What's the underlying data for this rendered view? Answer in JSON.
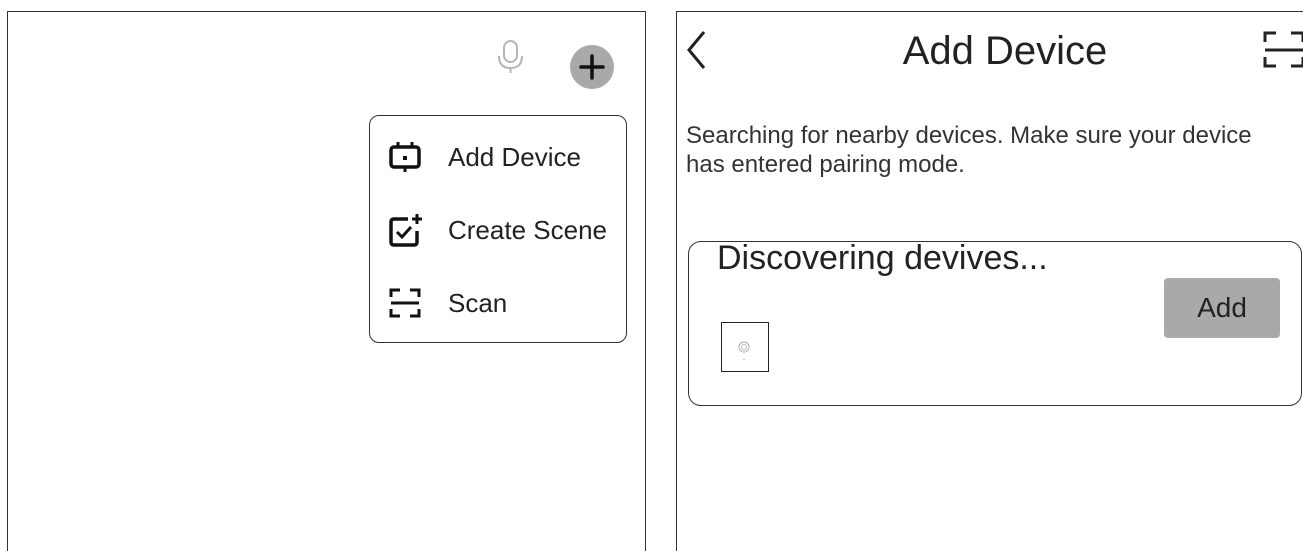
{
  "left_screen": {
    "toolbar": {
      "mic_icon": "microphone-icon",
      "add_icon": "plus-icon"
    },
    "menu": {
      "items": [
        {
          "label": "Add Device",
          "icon": "device-icon"
        },
        {
          "label": "Create Scene",
          "icon": "scene-icon"
        },
        {
          "label": "Scan",
          "icon": "scan-icon"
        }
      ]
    }
  },
  "right_screen": {
    "header": {
      "back_icon": "chevron-left-icon",
      "title": "Add Device",
      "scan_icon": "scan-icon"
    },
    "description_line1": "Searching for nearby devices. Make sure your device",
    "description_line2": "has entered pairing mode.",
    "card": {
      "title": "Discovering devives...",
      "add_label": "Add",
      "device_icon": "device-thumbnail-icon"
    }
  },
  "colors": {
    "border": "#333333",
    "button_gray": "#a9a9a9",
    "text": "#222222"
  }
}
